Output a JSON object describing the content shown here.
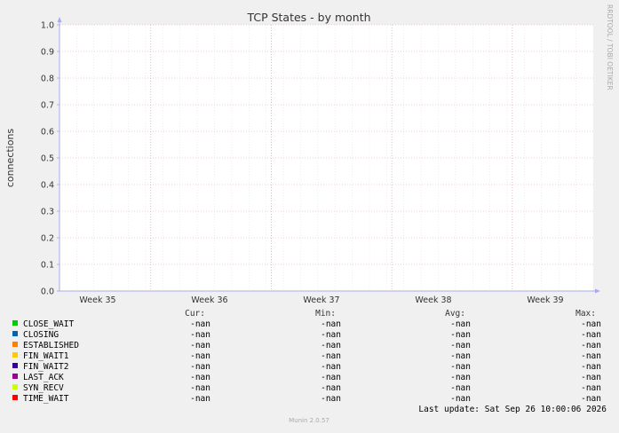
{
  "chart_data": {
    "type": "line",
    "title": "TCP States - by month",
    "ylabel": "connections",
    "xlabel": "",
    "ylim": [
      0,
      1.0
    ],
    "yticks": [
      "0.0",
      "0.1",
      "0.2",
      "0.3",
      "0.4",
      "0.5",
      "0.6",
      "0.7",
      "0.8",
      "0.9",
      "1.0"
    ],
    "xticks": [
      "Week 35",
      "Week 36",
      "Week 37",
      "Week 38",
      "Week 39"
    ],
    "grid": true,
    "watermark": "RRDTOOL / TOBI OETIKER",
    "legend_headers": {
      "cur": "Cur:",
      "min": "Min:",
      "avg": "Avg:",
      "max": "Max:"
    },
    "series": [
      {
        "name": "CLOSE_WAIT",
        "color": "#00cc00",
        "cur": "-nan",
        "min": "-nan",
        "avg": "-nan",
        "max": "-nan"
      },
      {
        "name": "CLOSING",
        "color": "#0066b3",
        "cur": "-nan",
        "min": "-nan",
        "avg": "-nan",
        "max": "-nan"
      },
      {
        "name": "ESTABLISHED",
        "color": "#ff8000",
        "cur": "-nan",
        "min": "-nan",
        "avg": "-nan",
        "max": "-nan"
      },
      {
        "name": "FIN_WAIT1",
        "color": "#ffcc00",
        "cur": "-nan",
        "min": "-nan",
        "avg": "-nan",
        "max": "-nan"
      },
      {
        "name": "FIN_WAIT2",
        "color": "#330099",
        "cur": "-nan",
        "min": "-nan",
        "avg": "-nan",
        "max": "-nan"
      },
      {
        "name": "LAST_ACK",
        "color": "#990099",
        "cur": "-nan",
        "min": "-nan",
        "avg": "-nan",
        "max": "-nan"
      },
      {
        "name": "SYN_RECV",
        "color": "#ccff00",
        "cur": "-nan",
        "min": "-nan",
        "avg": "-nan",
        "max": "-nan"
      },
      {
        "name": "TIME_WAIT",
        "color": "#ff0000",
        "cur": "-nan",
        "min": "-nan",
        "avg": "-nan",
        "max": "-nan"
      }
    ],
    "last_update": "Last update: Sat Sep 26 10:00:06 2026",
    "footer": "Munin 2.0.57"
  }
}
